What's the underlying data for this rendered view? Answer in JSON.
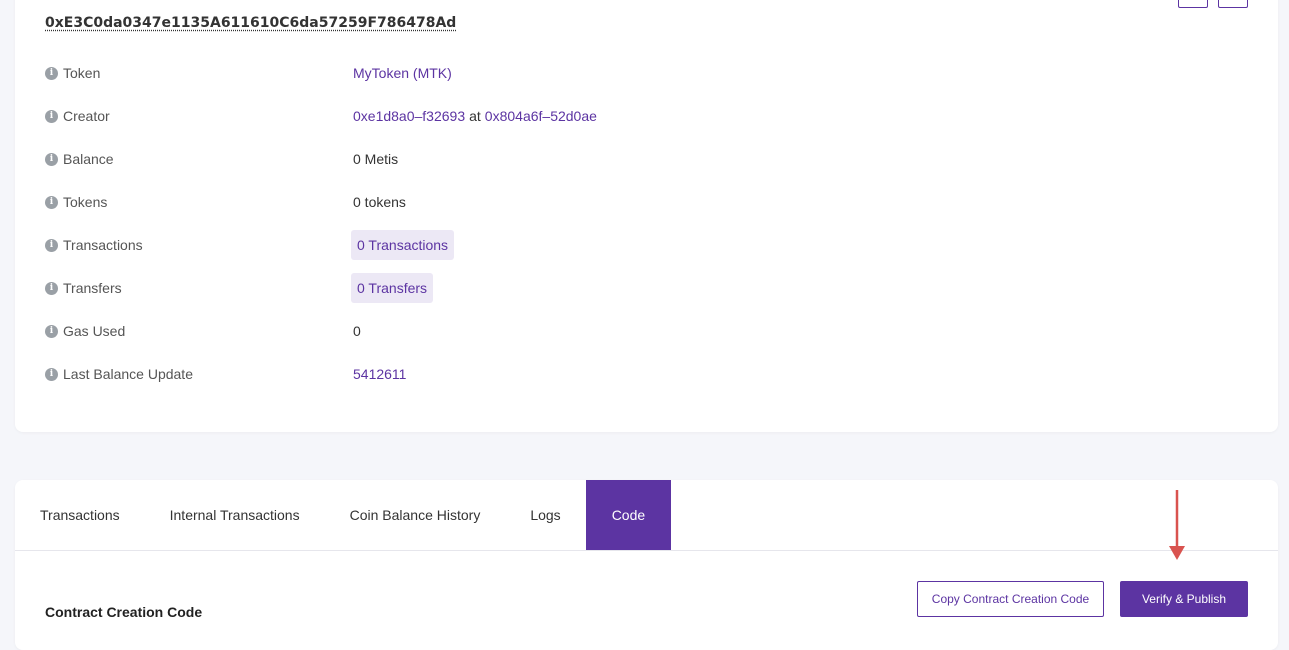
{
  "address": "0xE3C0da0347e1135A611610C6da57259F786478Ad",
  "details": [
    {
      "label": "Token",
      "type": "link",
      "value": "MyToken (MTK)"
    },
    {
      "label": "Creator",
      "type": "creator",
      "creator_link": "0xe1d8a0–f32693",
      "at_text": "at",
      "tx_link": "0x804a6f–52d0ae"
    },
    {
      "label": "Balance",
      "type": "text",
      "value": "0 Metis"
    },
    {
      "label": "Tokens",
      "type": "text",
      "value": "0 tokens"
    },
    {
      "label": "Transactions",
      "type": "chip",
      "value": "0 Transactions"
    },
    {
      "label": "Transfers",
      "type": "chip",
      "value": "0 Transfers"
    },
    {
      "label": "Gas Used",
      "type": "text",
      "value": "0"
    },
    {
      "label": "Last Balance Update",
      "type": "link",
      "value": "5412611"
    }
  ],
  "tabs": [
    {
      "label": "Transactions",
      "active": false
    },
    {
      "label": "Internal Transactions",
      "active": false
    },
    {
      "label": "Coin Balance History",
      "active": false
    },
    {
      "label": "Logs",
      "active": false
    },
    {
      "label": "Code",
      "active": true
    }
  ],
  "code_section": {
    "title": "Contract Creation Code",
    "copy_button": "Copy Contract Creation Code",
    "verify_button": "Verify & Publish"
  },
  "info_icon_glyph": "i",
  "colors": {
    "accent": "#5c34a2",
    "annotation_arrow": "#d9534f"
  }
}
